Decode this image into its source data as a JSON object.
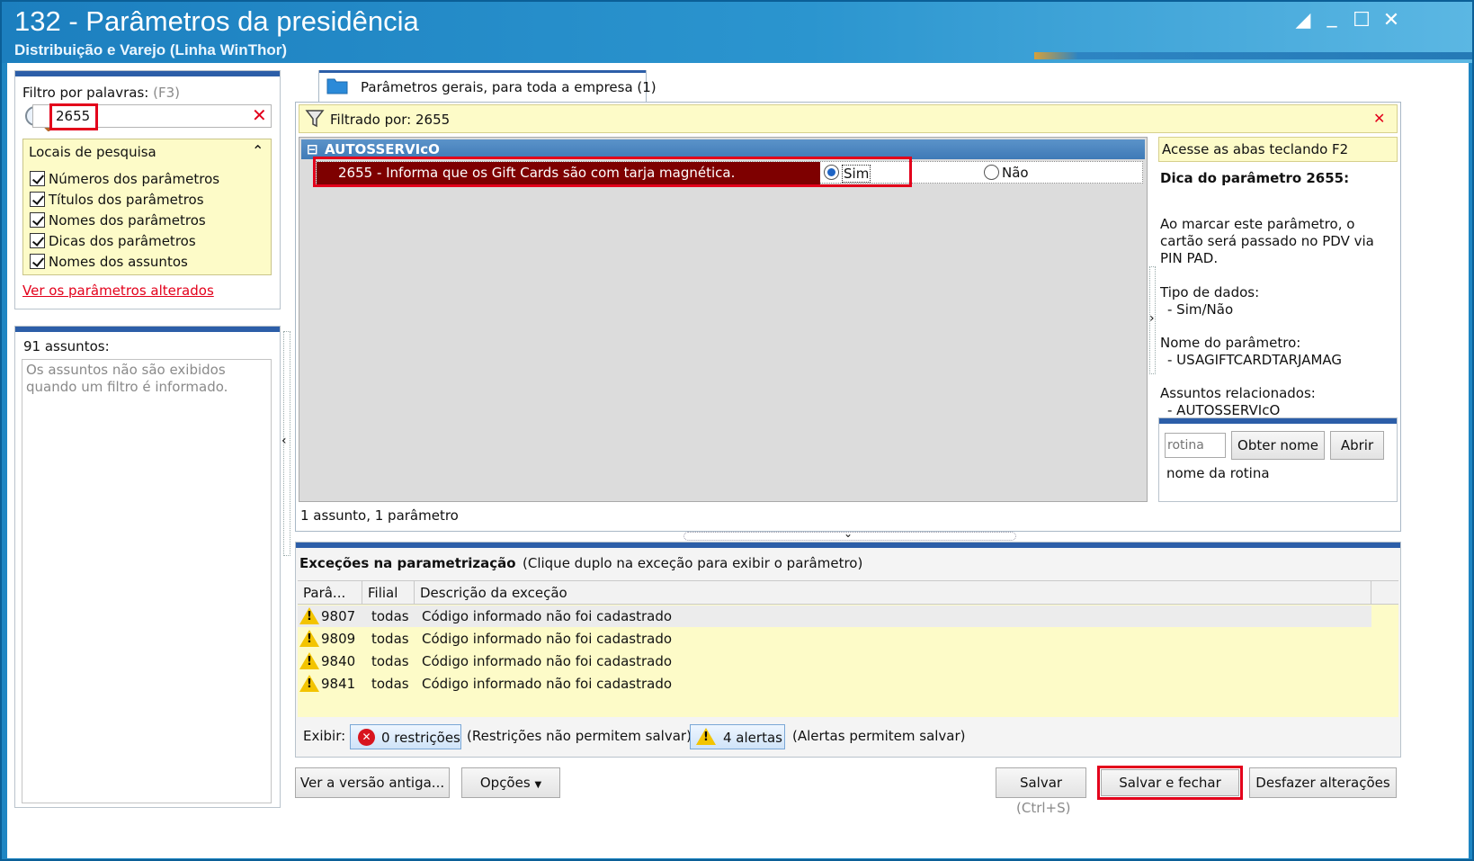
{
  "window": {
    "title": "132 - Parâmetros da presidência",
    "subtitle": "Distribuição e Varejo (Linha WinThor)"
  },
  "filter": {
    "label": "Filtro por palavras:",
    "shortcut": "(F3)",
    "value": "2655"
  },
  "search_places": {
    "title": "Locais de pesquisa",
    "items": [
      "Números dos parâmetros",
      "Títulos dos parâmetros",
      "Nomes dos parâmetros",
      "Dicas dos parâmetros",
      "Nomes dos assuntos"
    ],
    "changed_link": "Ver os parâmetros alterados"
  },
  "subjects": {
    "count_label": "91 assuntos:",
    "note": "Os assuntos não são exibidos quando um filtro é informado."
  },
  "tab": {
    "label": "Parâmetros gerais, para toda a empresa  (1)"
  },
  "filtered_by": "Filtrado por: 2655",
  "group": "AUTOSSERVIcO",
  "param": {
    "description": "2655 - Informa que os Gift Cards são com tarja magnética.",
    "yes": "Sim",
    "no": "Não"
  },
  "summary": "1 assunto, 1 parâmetro",
  "info": {
    "hint": "Acesse as abas teclando F2",
    "tip_title": "Dica do parâmetro 2655:",
    "tip_text": "Ao marcar este parâmetro, o cartão será passado no PDV via PIN PAD.",
    "type_label": "Tipo de dados:",
    "type_value": "- Sim/Não",
    "name_label": "Nome do parâmetro:",
    "name_value": "- USAGIFTCARDTARJAMAG",
    "related_label": "Assuntos relacionados:",
    "related_value": "- AUTOSSERVIcO"
  },
  "rotina": {
    "placeholder": "rotina",
    "get_name": "Obter nome",
    "open": "Abrir",
    "name_label": "nome da rotina"
  },
  "exceptions": {
    "title": "Exceções na parametrização",
    "hint": "(Clique duplo na exceção para exibir o parâmetro)",
    "columns": [
      "Parâ...",
      "Filial",
      "Descrição da exceção"
    ],
    "rows": [
      {
        "param": "9807",
        "filial": "todas",
        "desc": "Código informado não foi cadastrado"
      },
      {
        "param": "9809",
        "filial": "todas",
        "desc": "Código informado não foi cadastrado"
      },
      {
        "param": "9840",
        "filial": "todas",
        "desc": "Código informado não foi cadastrado"
      },
      {
        "param": "9841",
        "filial": "todas",
        "desc": "Código informado não foi cadastrado"
      }
    ],
    "show_label": "Exibir:",
    "restrictions": "0 restrições",
    "restrictions_note": "(Restrições não permitem salvar)",
    "alerts": "4 alertas",
    "alerts_note": "(Alertas permitem salvar)"
  },
  "footer": {
    "old_version": "Ver a versão antiga...",
    "options": "Opções",
    "save": "Salvar",
    "save_shortcut": "(Ctrl+S)",
    "save_close": "Salvar e fechar",
    "undo": "Desfazer alterações"
  },
  "colors": {
    "accent_blue": "#2c5ea8",
    "highlight_red": "#e3001b",
    "selected_row": "#7e0000",
    "yellow_bg": "#fdfbc8"
  }
}
